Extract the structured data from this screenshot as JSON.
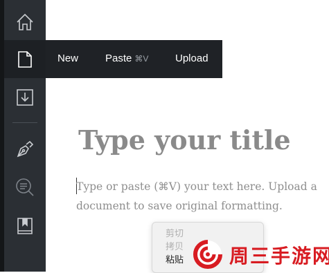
{
  "sidebar": {
    "items": [
      {
        "name": "home",
        "icon": "home-icon"
      },
      {
        "name": "new-document",
        "icon": "document-icon"
      },
      {
        "name": "download",
        "icon": "download-icon"
      },
      {
        "name": "write",
        "icon": "pen-nib-icon"
      },
      {
        "name": "search-text",
        "icon": "search-lines-icon"
      },
      {
        "name": "library",
        "icon": "book-bookmark-icon"
      }
    ]
  },
  "dropdown": {
    "new_label": "New",
    "paste_label": "Paste",
    "paste_shortcut": "⌘V",
    "upload_label": "Upload"
  },
  "editor": {
    "title_placeholder": "Type your title",
    "body_placeholder": "Type or paste (⌘V) your text here. Upload a document to save original formatting."
  },
  "context_menu": {
    "items": [
      {
        "label": "剪切",
        "enabled": false
      },
      {
        "label": "拷贝",
        "enabled": false
      },
      {
        "label": "粘贴",
        "enabled": true
      }
    ]
  },
  "watermark": {
    "text": "周三手游网"
  },
  "colors": {
    "sidebar_bg": "#2b2f34",
    "menu_bg": "#1f2226",
    "placeholder": "#8a8a8a",
    "watermark_red": "#d81c22"
  }
}
